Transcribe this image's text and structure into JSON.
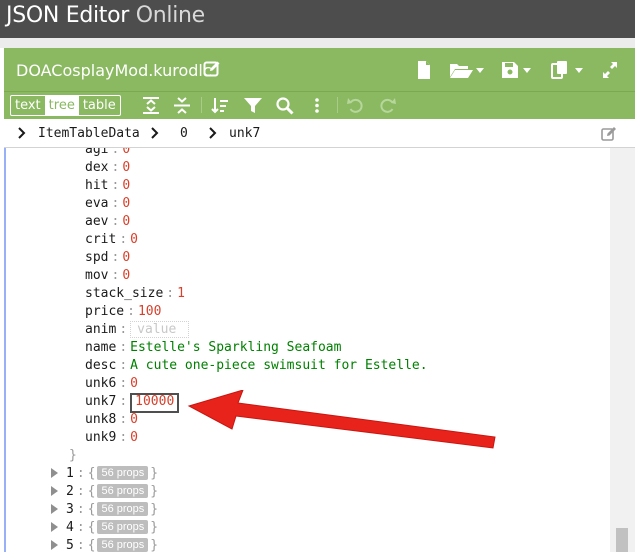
{
  "app": {
    "title_main": "JSON Editor",
    "title_light": "Online"
  },
  "document": {
    "name": "DOACosplayMod.kurodlc"
  },
  "modes": [
    "text",
    "tree",
    "table"
  ],
  "active_mode": "tree",
  "breadcrumb": [
    "ItemTableData",
    "0",
    "unk7"
  ],
  "fields": [
    {
      "key": "agi",
      "value": "0",
      "type": "number"
    },
    {
      "key": "dex",
      "value": "0",
      "type": "number"
    },
    {
      "key": "hit",
      "value": "0",
      "type": "number"
    },
    {
      "key": "eva",
      "value": "0",
      "type": "number"
    },
    {
      "key": "aev",
      "value": "0",
      "type": "number"
    },
    {
      "key": "crit",
      "value": "0",
      "type": "number"
    },
    {
      "key": "spd",
      "value": "0",
      "type": "number"
    },
    {
      "key": "mov",
      "value": "0",
      "type": "number"
    },
    {
      "key": "stack_size",
      "value": "1",
      "type": "number"
    },
    {
      "key": "price",
      "value": "100",
      "type": "number"
    },
    {
      "key": "anim",
      "value": "value",
      "type": "empty"
    },
    {
      "key": "name",
      "value": "Estelle's Sparkling Seafoam",
      "type": "string"
    },
    {
      "key": "desc",
      "value": "A cute one-piece swimsuit for Estelle.",
      "type": "string"
    },
    {
      "key": "unk6",
      "value": "0",
      "type": "number"
    },
    {
      "key": "unk7",
      "value": "10000",
      "type": "number",
      "highlighted": true
    },
    {
      "key": "unk8",
      "value": "0",
      "type": "number"
    },
    {
      "key": "unk9",
      "value": "0",
      "type": "number"
    }
  ],
  "closing_brace": "}",
  "collapsed_items": [
    {
      "index": "1",
      "open": "{",
      "props": "56 props",
      "close": "}"
    },
    {
      "index": "2",
      "open": "{",
      "props": "56 props",
      "close": "}"
    },
    {
      "index": "3",
      "open": "{",
      "props": "56 props",
      "close": "}"
    },
    {
      "index": "4",
      "open": "{",
      "props": "56 props",
      "close": "}"
    },
    {
      "index": "5",
      "open": "{",
      "props": "56 props",
      "close": "}"
    }
  ],
  "colors": {
    "header_bg": "#4d4d4d",
    "accent_green": "#8ab961",
    "number": "#d9402b",
    "string": "#008000",
    "arrow": "#e8231c"
  }
}
